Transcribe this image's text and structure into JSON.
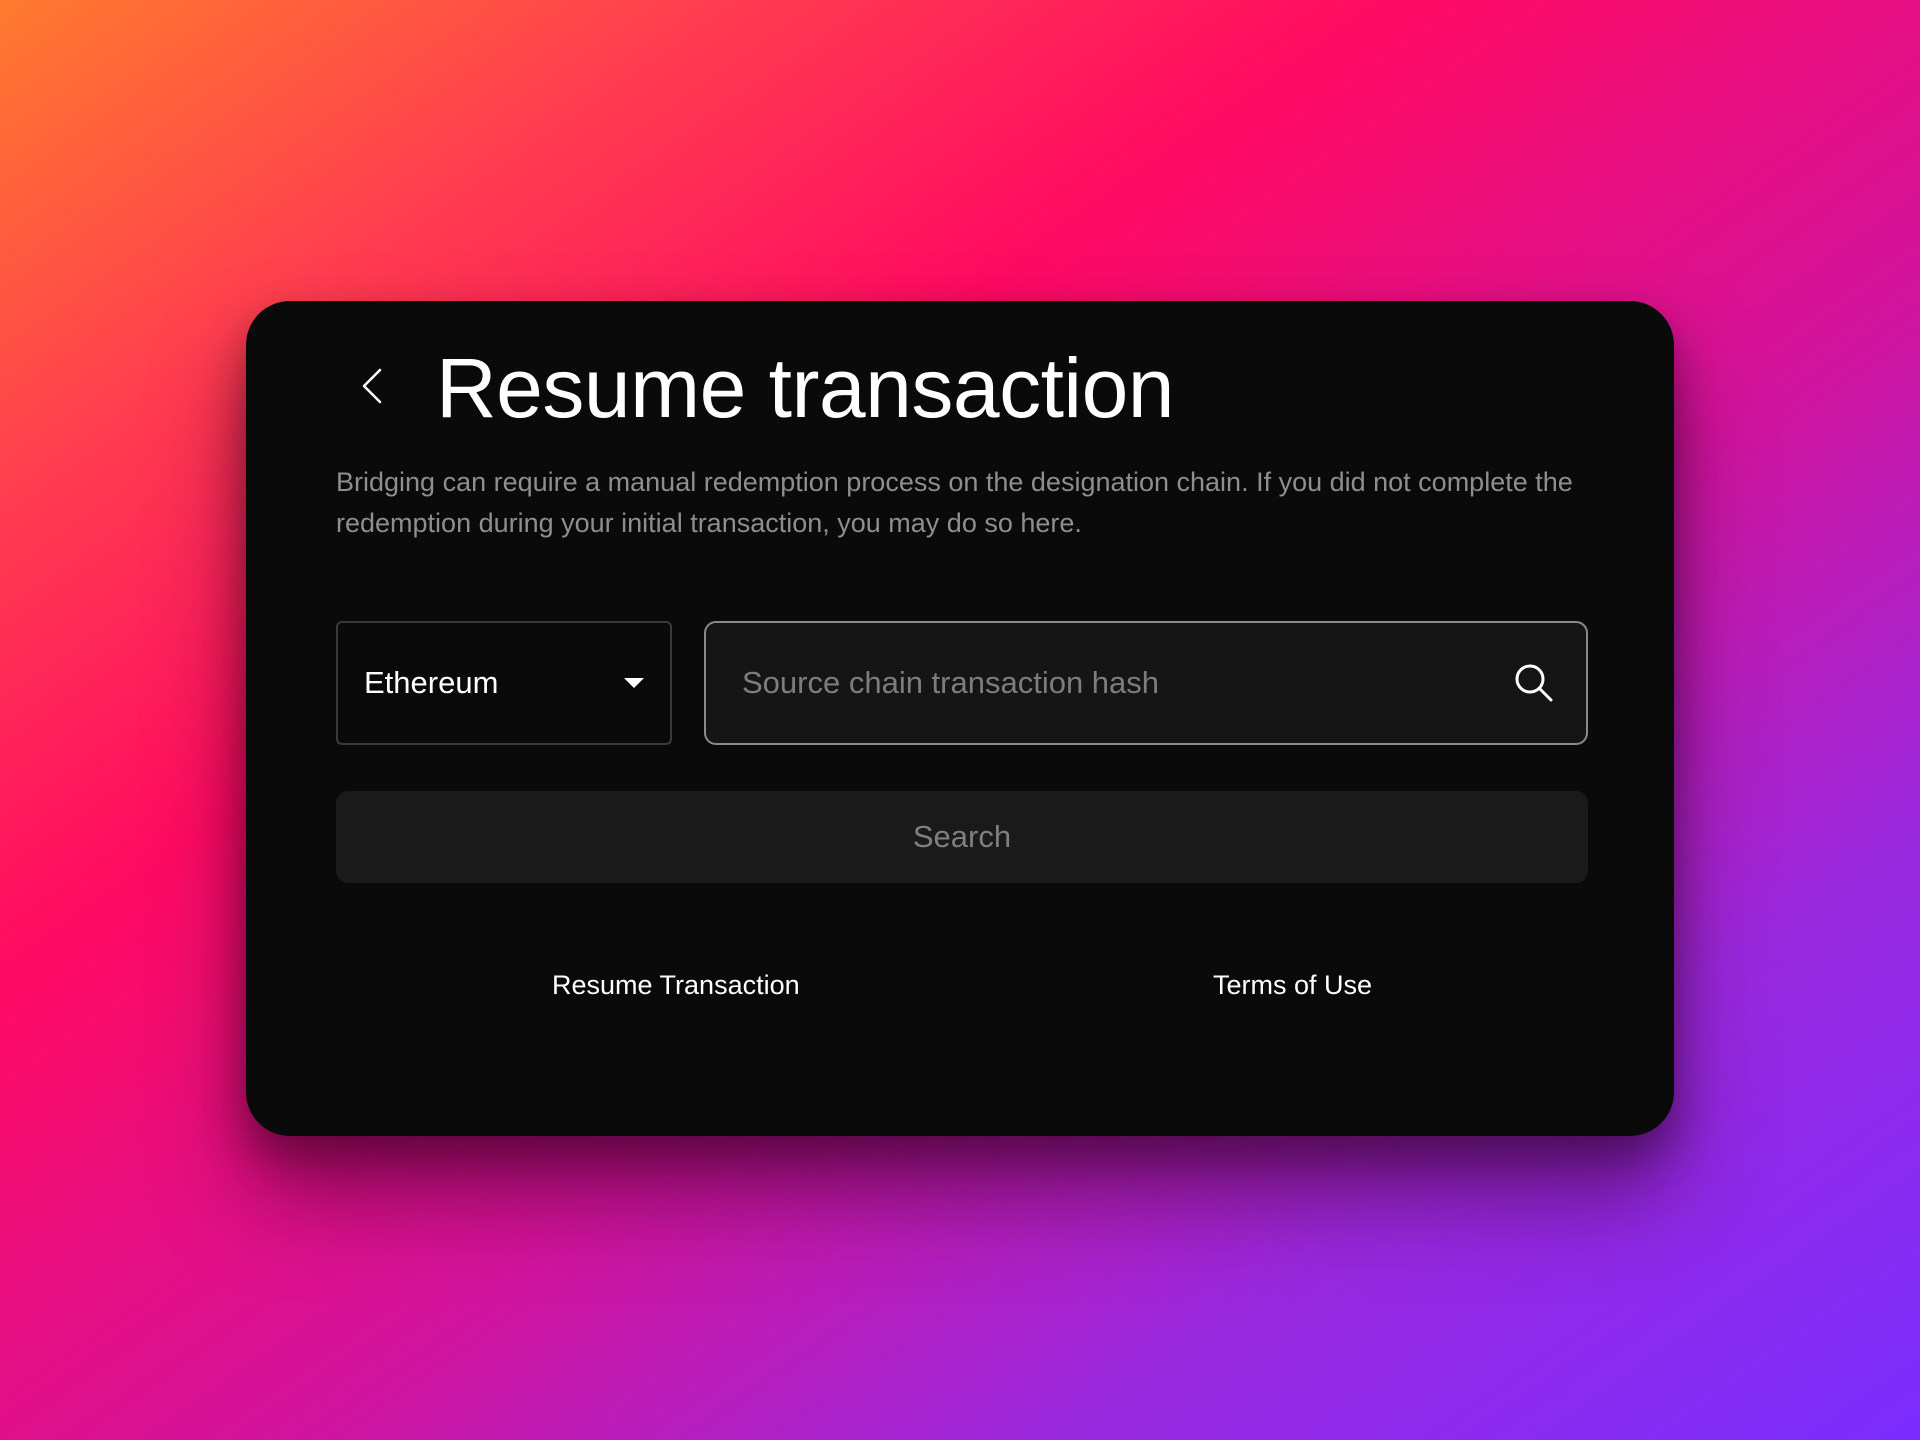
{
  "header": {
    "title": "Resume transaction",
    "back_icon": "chevron-left-icon"
  },
  "description": "Bridging can require a manual redemption process on the designation chain. If you did not complete the redemption during your initial transaction, you may do so here.",
  "chain_select": {
    "selected": "Ethereum",
    "icon": "caret-down-icon"
  },
  "hash_input": {
    "value": "",
    "placeholder": "Source chain transaction hash",
    "icon": "search-icon"
  },
  "search_button": {
    "label": "Search"
  },
  "footer": {
    "links": [
      {
        "label": "Resume Transaction"
      },
      {
        "label": "Terms of Use"
      }
    ]
  },
  "colors": {
    "card_background": "#0a0a0a",
    "text_primary": "#ffffff",
    "text_muted": "#8e8e8e",
    "button_background": "#1a1a1a",
    "background_gradient": [
      "#ff7a2e",
      "#ff0a62",
      "#d4139b",
      "#7b2dff"
    ]
  }
}
